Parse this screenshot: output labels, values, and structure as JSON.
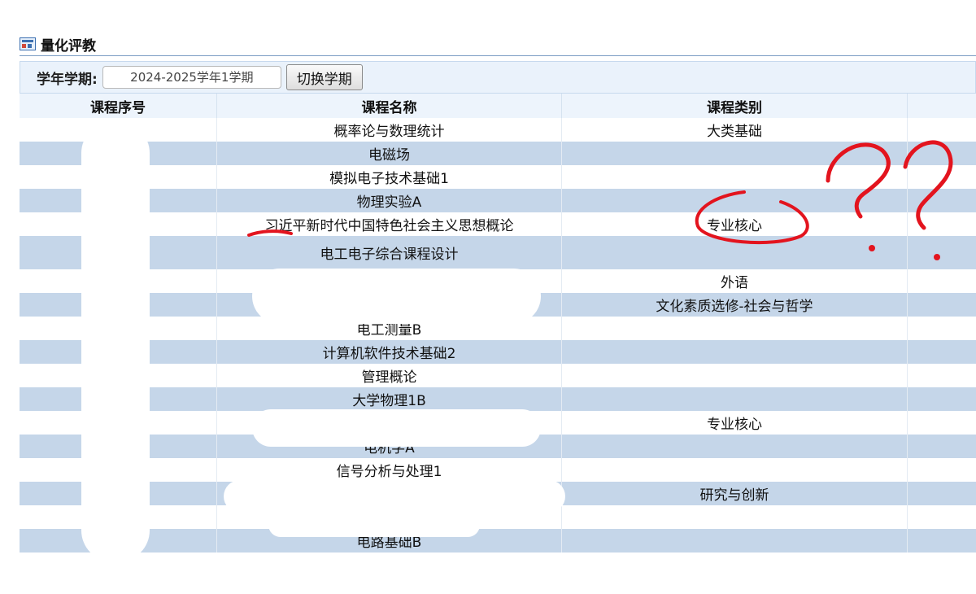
{
  "panel": {
    "title": "量化评教",
    "icon": "table-form-icon"
  },
  "term": {
    "label": "学年学期:",
    "selected": "2024-2025学年1学期",
    "switch_label": "切换学期"
  },
  "table": {
    "headers": [
      "课程序号",
      "课程名称",
      "课程类别",
      ""
    ],
    "rows": [
      {
        "name": "概率论与数理统计",
        "category": "大类基础"
      },
      {
        "name": "电磁场",
        "category": ""
      },
      {
        "name": "模拟电子技术基础1",
        "category": ""
      },
      {
        "name": "物理实验A",
        "category": ""
      },
      {
        "name_hl": "习近平",
        "name_rest": "新时代中国特色社会主义思想概论",
        "category": "专业核心"
      },
      {
        "name": "电工电子综合课程设计",
        "category": ""
      },
      {
        "name": "",
        "category": "外语"
      },
      {
        "name": "",
        "category": "文化素质选修-社会与哲学"
      },
      {
        "name": "电工测量B",
        "category": ""
      },
      {
        "name": "计算机软件技术基础2",
        "category": ""
      },
      {
        "name": "管理概论",
        "category": ""
      },
      {
        "name": "大学物理1B",
        "category": ""
      },
      {
        "name": "",
        "category": "专业核心"
      },
      {
        "name": "电机学A",
        "category": ""
      },
      {
        "name": "信号分析与处理1",
        "category": ""
      },
      {
        "name": "",
        "category": "研究与创新"
      },
      {
        "name": "",
        "category": ""
      },
      {
        "name": "电路基础B",
        "category": ""
      }
    ]
  },
  "annotation_color": "#e3141e"
}
